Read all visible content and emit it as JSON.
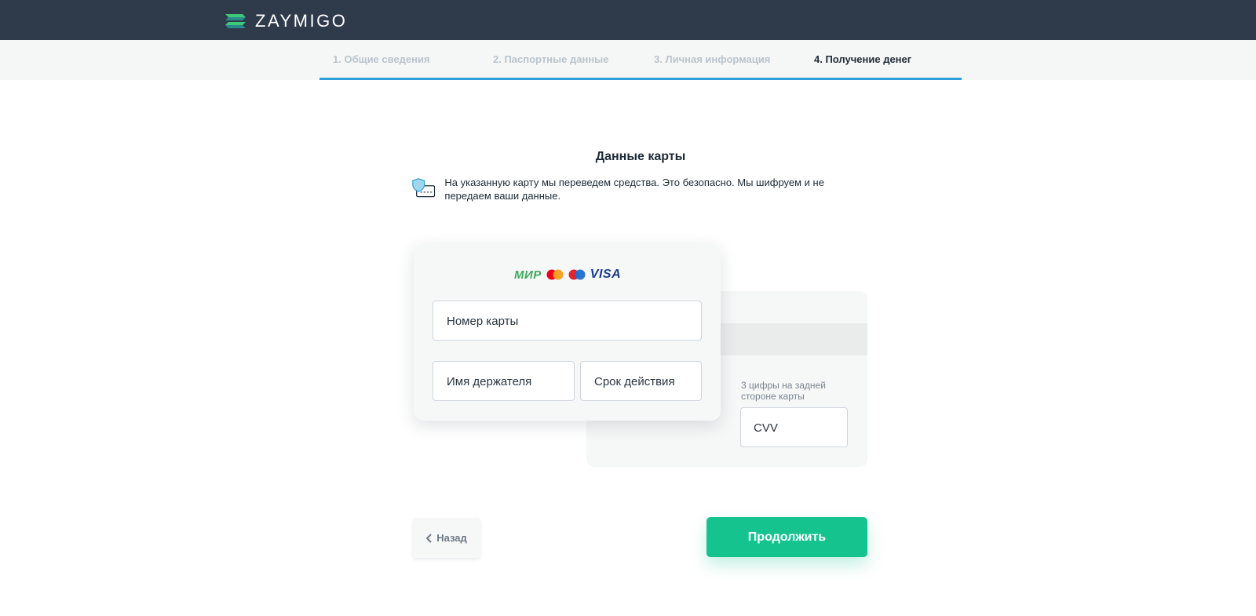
{
  "header": {
    "logo_text": "ZAYMIGO"
  },
  "steps": [
    {
      "label": "1. Общие сведения",
      "active": false
    },
    {
      "label": "2. Паспортные данные",
      "active": false
    },
    {
      "label": "3. Личная информация",
      "active": false
    },
    {
      "label": "4. Получение денег",
      "active": true
    }
  ],
  "main": {
    "title": "Данные карты",
    "notice": "На указанную карту мы переведем средства. Это безопасно. Мы шифруем и не передаем ваши данные."
  },
  "card_front": {
    "brand_mir": "МИР",
    "brand_visa": "VISA",
    "number_placeholder": "Номер карты",
    "holder_placeholder": "Имя держателя",
    "expiry_placeholder": "Срок действия"
  },
  "card_back": {
    "cvv_hint": "3 цифры на задней стороне карты",
    "cvv_placeholder": "CVV"
  },
  "buttons": {
    "back_label": "Назад",
    "continue_label": "Продолжить"
  },
  "colors": {
    "header_bg": "#2f3b4b",
    "accent_blue": "#2d9fd9",
    "accent_green": "#14c38e"
  },
  "icons": {
    "logo": "zaymigo-logo-icon",
    "notice": "shield-card-icon",
    "back": "chevron-left-icon"
  }
}
